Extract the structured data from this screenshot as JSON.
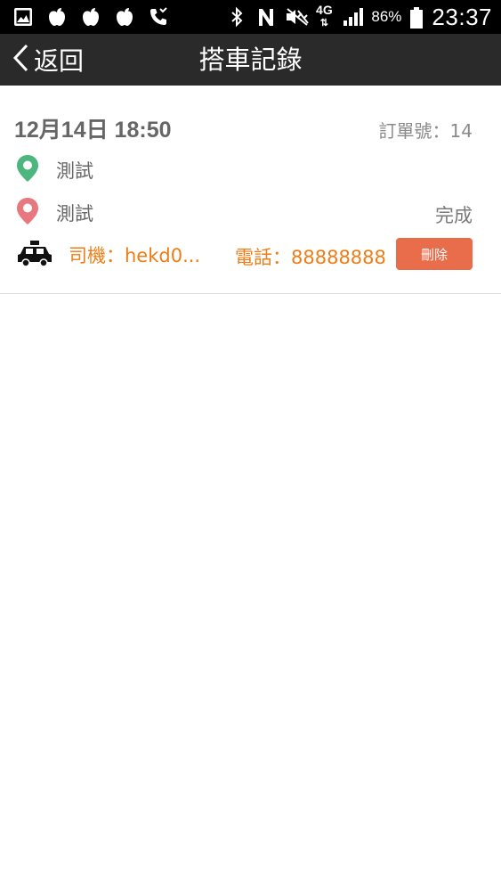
{
  "status_bar": {
    "battery_percent": "86%",
    "time": "23:37",
    "network_type": "4G",
    "icons": [
      "gallery-icon",
      "apple-icon",
      "apple-icon",
      "apple-icon",
      "missed-call-icon",
      "bluetooth-icon",
      "nfc-icon",
      "muted-icon",
      "signal-icon",
      "battery-icon"
    ]
  },
  "nav": {
    "back_label": "返回",
    "title": "搭車記錄"
  },
  "record": {
    "datetime": "12月14日 18:50",
    "order_number": "訂單號：14",
    "origin": "測試",
    "destination": "測試",
    "status": "完成",
    "driver": "司機：hekd0...",
    "phone": "電話：88888888",
    "delete_label": "刪除",
    "colors": {
      "origin_pin": "#4db57e",
      "destination_pin": "#e8787f",
      "accent": "#ef7d16",
      "delete_button": "#e96c4b"
    }
  }
}
